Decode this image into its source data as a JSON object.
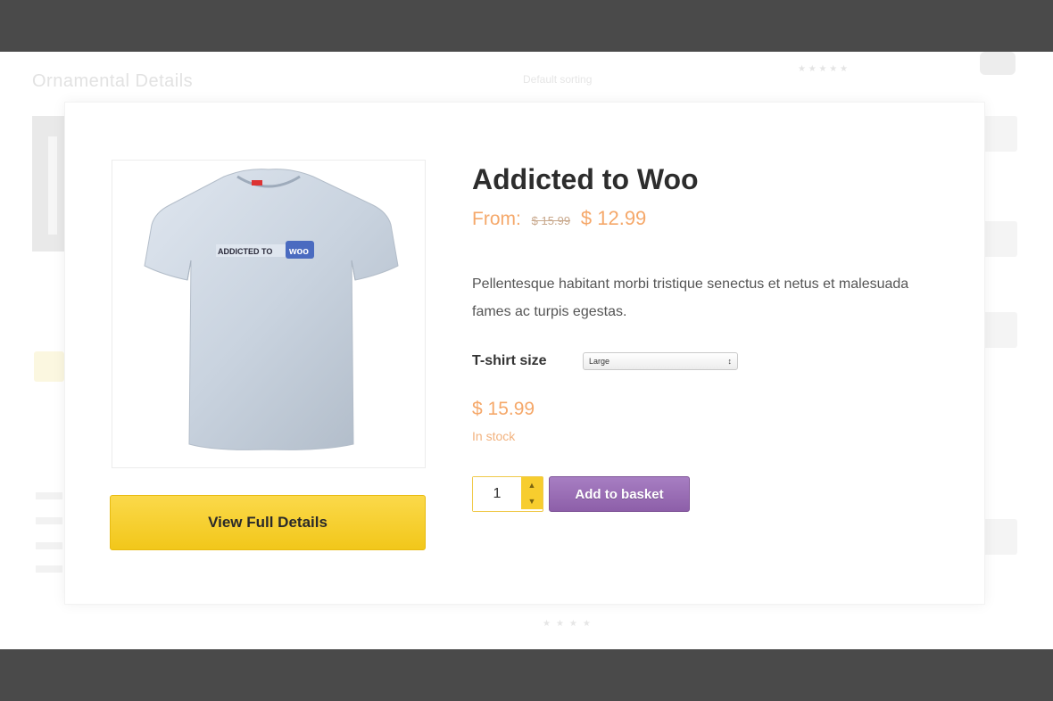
{
  "background_page": {
    "title": "Ornamental Details",
    "sort_label": "Default sorting",
    "stars": "★ ★ ★ ★ ★",
    "bottom_stars": "★★★★"
  },
  "product": {
    "title": "Addicted to Woo",
    "price_prefix": "From:",
    "old_price": "$ 15.99",
    "sale_price": "$ 12.99",
    "description": "Pellentesque habitant morbi tristique senectus et netus et malesuada fames ac turpis egestas.",
    "image_alt_text": "ADDICTED TO",
    "image_logo_text": "woo"
  },
  "variation": {
    "label": "T-shirt size",
    "selected": "Large"
  },
  "variant_price": "$ 15.99",
  "stock_status": "In stock",
  "quantity": "1",
  "buttons": {
    "view_details": "View Full Details",
    "add_to_basket": "Add to basket"
  },
  "colors": {
    "accent_orange": "#f5a86a",
    "view_button": "#f5cc26",
    "add_button": "#9b6eb8",
    "frame": "#4a4a4a"
  }
}
